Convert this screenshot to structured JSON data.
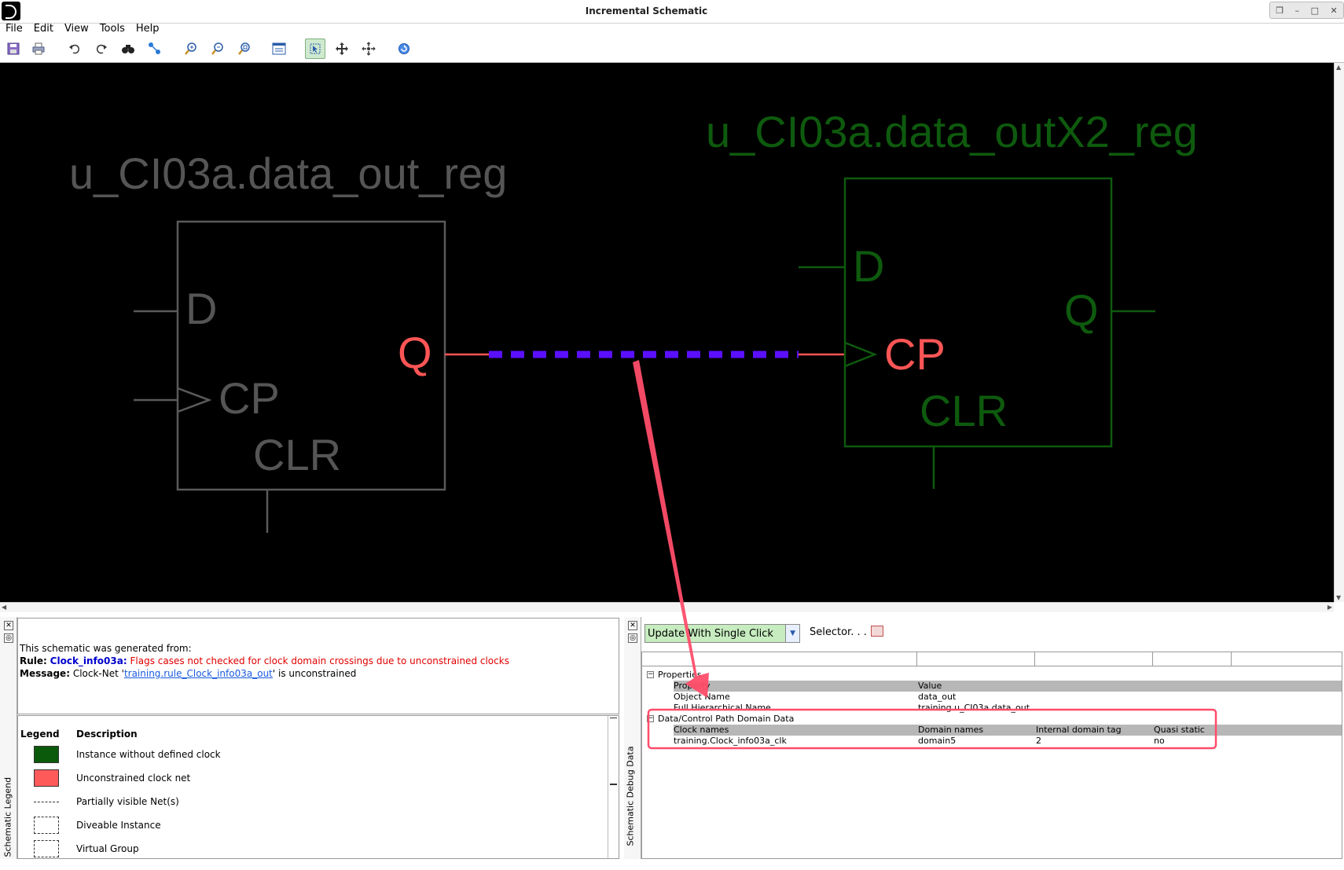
{
  "window": {
    "title": "Incremental Schematic",
    "controls": [
      "restore-icon",
      "minimize-icon",
      "maximize-icon",
      "close-icon"
    ]
  },
  "menu": [
    "File",
    "Edit",
    "View",
    "Tools",
    "Help"
  ],
  "toolbar": {
    "icons": [
      "save-icon",
      "print-icon",
      "undo-icon",
      "redo-icon",
      "find-icon",
      "trace-icon",
      "zoom-in-icon",
      "zoom-out-icon",
      "zoom-fit-icon",
      "properties-icon",
      "select-mode-icon",
      "pan-icon",
      "expand-icon",
      "refresh-icon"
    ],
    "active": "select-mode-icon"
  },
  "schematic": {
    "left_instance": {
      "name": "u_CI03a.data_out_reg",
      "pins": {
        "d": "D",
        "cp": "CP",
        "clr": "CLR",
        "q": "Q"
      },
      "color": "#555555"
    },
    "right_instance": {
      "name": "u_CI03a.data_outX2_reg",
      "pins": {
        "d": "D",
        "cp": "CP",
        "clr": "CLR",
        "q": "Q"
      },
      "color": "#0e5a0e"
    },
    "highlight_color": "#ff5555",
    "partial_net_color": "#5a10ff",
    "annotation_color": "#ff4d6a"
  },
  "legend_panel": {
    "strip_label": "Schematic Legend",
    "generated_from": "This schematic was generated from:",
    "rule_label": "Rule:",
    "rule_name": "Clock_info03a:",
    "rule_desc": "Flags cases not checked for clock domain crossings due to unconstrained clocks",
    "message_label": "Message:",
    "message_prefix": "Clock-Net '",
    "message_link": "training.rule_Clock_info03a_out",
    "message_suffix": "' is unconstrained",
    "headers": {
      "legend": "Legend",
      "description": "Description"
    },
    "rows": [
      {
        "text": "Instance without defined clock",
        "swatch": "#0b5a0b"
      },
      {
        "text": "Unconstrained clock net",
        "swatch": "#ff5a5a"
      },
      {
        "text": "Partially visible Net(s)",
        "swatch": "dashed-line"
      },
      {
        "text": "Diveable Instance",
        "swatch": "dashdot-box"
      },
      {
        "text": "Virtual Group",
        "swatch": "dashed-box"
      }
    ]
  },
  "debug_panel": {
    "strip_label": "Schematic Debug Data",
    "update_mode": "Update With Single Click",
    "selector_label": "Selector. . .",
    "properties_label": "Properties",
    "properties_header": {
      "name": "Property",
      "value": "Value"
    },
    "properties_rows": [
      {
        "name": "Object Name",
        "value": "data_out"
      },
      {
        "name": "Full Hierarchical Name",
        "value": "training.u_CI03a.data_out"
      }
    ],
    "domain_label": "Data/Control Path Domain Data",
    "domain_header": {
      "clock": "Clock names",
      "domain": "Domain names",
      "tag": "Internal domain tag",
      "quasi": "Quasi static"
    },
    "domain_rows": [
      {
        "clock": "training.Clock_info03a_clk",
        "domain": "domain5",
        "tag": "2",
        "quasi": "no"
      }
    ]
  }
}
